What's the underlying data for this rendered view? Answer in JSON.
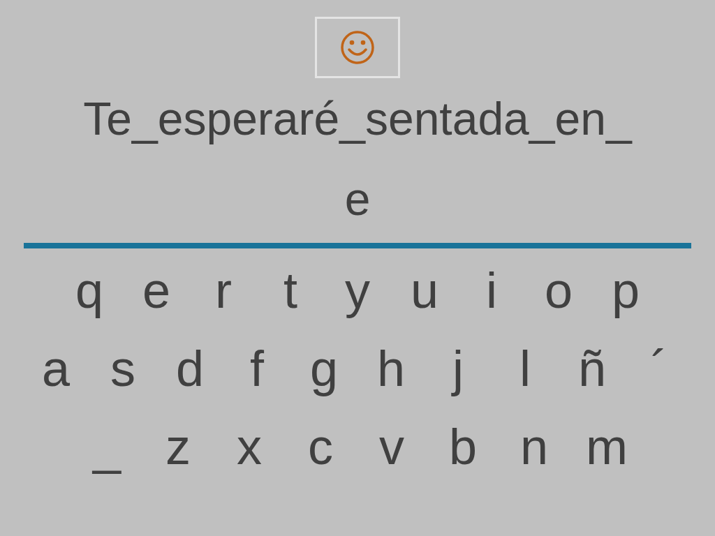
{
  "sentence": "Te_esperaré_sentada_en_",
  "answer": "e",
  "keyboard": {
    "rows": [
      [
        "q",
        "e",
        "r",
        "t",
        "y",
        "u",
        "i",
        "o",
        "p"
      ],
      [
        "a",
        "s",
        "d",
        "f",
        "g",
        "h",
        "j",
        "l",
        "ñ",
        "´"
      ],
      [
        "_",
        "z",
        "x",
        "c",
        "v",
        "b",
        "n",
        "m"
      ]
    ]
  }
}
